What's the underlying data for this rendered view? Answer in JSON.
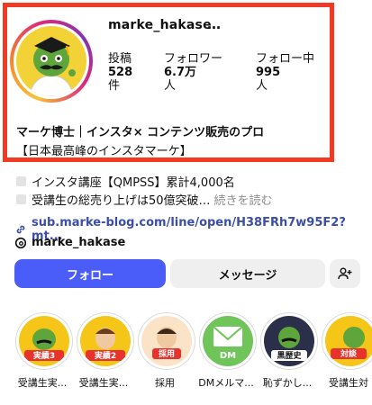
{
  "profile": {
    "username": "marke_hakase",
    "more_icon": "…"
  },
  "stats": [
    {
      "label": "投稿",
      "value": "528",
      "unit": "件"
    },
    {
      "label": "フォロワー",
      "value": "6.7万",
      "unit": "人"
    },
    {
      "label": "フォロー中",
      "value": "995",
      "unit": "人"
    }
  ],
  "bio": {
    "name": "マーケ博士｜インスタ× コンテンツ販売のプロ",
    "tagline": "【日本最高峰のインスタマーケ】",
    "line1": "インスタ講座【QMPSS】累計4,000名",
    "line2": "受講生の総売り上げは50億突破…",
    "more": "続きを読む",
    "link": "sub.marke-blog.com/line/open/H38FRh7w95F2?mt...",
    "threads": "marke_hakase"
  },
  "buttons": {
    "follow": "フォロー",
    "message": "メッセージ"
  },
  "highlights": [
    {
      "label": "受講生実...",
      "badge": "実績3"
    },
    {
      "label": "受講生実...",
      "badge": "実績2"
    },
    {
      "label": "採用",
      "badge": "採用"
    },
    {
      "label": "DMメルマ...",
      "badge": "DM"
    },
    {
      "label": "恥ずかし...",
      "badge": "黒歴史"
    },
    {
      "label": "受講生対",
      "badge": "対談"
    }
  ],
  "colors": {
    "highlight_box": "#f03a24",
    "follow_button": "#4a5df9",
    "link": "#3b4ea8"
  }
}
